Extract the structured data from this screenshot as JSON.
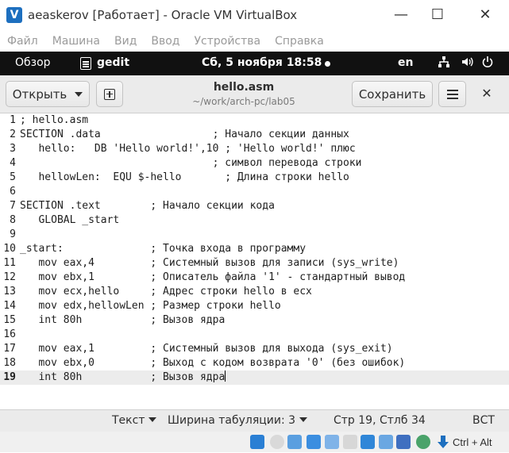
{
  "window": {
    "title": "aeaskerov [Работает] - Oracle VM VirtualBox",
    "minimize": "—",
    "maximize": "☐",
    "close": "✕"
  },
  "vbox_menu": [
    "Файл",
    "Машина",
    "Вид",
    "Ввод",
    "Устройства",
    "Справка"
  ],
  "topbar": {
    "activities": "Обзор",
    "app_name": "gedit",
    "clock": "Сб, 5 ноября  18:58",
    "language": "en",
    "icons": [
      "network-icon",
      "volume-icon",
      "power-icon"
    ]
  },
  "gedit": {
    "open_label": "Открыть",
    "doc_title": "hello.asm",
    "doc_path": "~/work/arch-pc/lab05",
    "save_label": "Сохранить",
    "close_glyph": "✕"
  },
  "editor": {
    "current_line": 19,
    "lines": [
      "; hello.asm",
      "SECTION .data                  ; Начало секции данных",
      "   hello:   DB 'Hello world!',10 ; 'Hello world!' плюс",
      "                               ; символ перевода строки",
      "   hellowLen:  EQU $-hello       ; Длина строки hello",
      "",
      "SECTION .text        ; Начало секции кода",
      "   GLOBAL _start",
      "",
      "_start:              ; Точка входа в программу",
      "   mov eax,4         ; Системный вызов для записи (sys_write)",
      "   mov ebx,1         ; Описатель файла '1' - стандартный вывод",
      "   mov ecx,hello     ; Адрес строки hello в ecx",
      "   mov edx,hellowLen ; Размер строки hello",
      "   int 80h           ; Вызов ядра",
      "",
      "   mov eax,1         ; Системный вызов для выхода (sys_exit)",
      "   mov ebx,0         ; Выход с кодом возврата '0' (без ошибок)",
      "   int 80h           ; Вызов ядра"
    ]
  },
  "statusbar": {
    "syntax": "Текст",
    "tab_width": "Ширина табуляции: 3",
    "position": "Стр 19, Стлб 34",
    "insert_mode": "ВСТ"
  },
  "vbox_status": {
    "host_key": "Ctrl + Alt"
  },
  "colors": {
    "topbar_bg": "#111111",
    "header_bg": "#ebebeb",
    "current_line_bg": "#ececec",
    "vbox_blue": "#1d6fbf"
  }
}
